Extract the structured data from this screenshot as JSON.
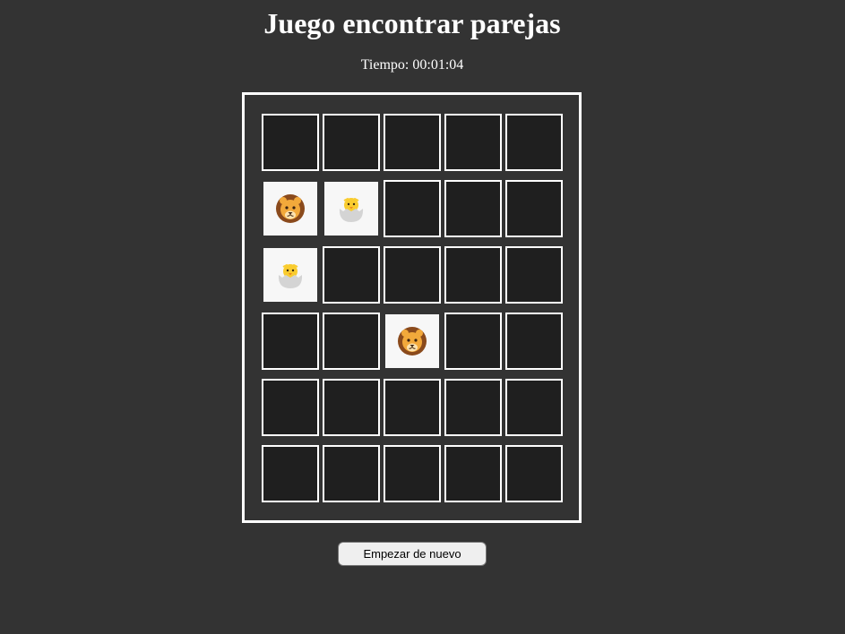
{
  "header": {
    "title": "Juego encontrar parejas"
  },
  "timer": {
    "text": "Tiempo: 00:01:04"
  },
  "board": {
    "rows": 6,
    "cols": 5,
    "cards": [
      {
        "state": "hidden"
      },
      {
        "state": "hidden"
      },
      {
        "state": "hidden"
      },
      {
        "state": "hidden"
      },
      {
        "state": "hidden"
      },
      {
        "state": "revealed",
        "icon": "lion-face-icon"
      },
      {
        "state": "revealed",
        "icon": "hatching-chick-icon"
      },
      {
        "state": "hidden"
      },
      {
        "state": "hidden"
      },
      {
        "state": "hidden"
      },
      {
        "state": "revealed",
        "icon": "hatching-chick-icon"
      },
      {
        "state": "hidden"
      },
      {
        "state": "hidden"
      },
      {
        "state": "hidden"
      },
      {
        "state": "hidden"
      },
      {
        "state": "hidden"
      },
      {
        "state": "hidden"
      },
      {
        "state": "revealed",
        "icon": "lion-face-icon"
      },
      {
        "state": "hidden"
      },
      {
        "state": "hidden"
      },
      {
        "state": "hidden"
      },
      {
        "state": "hidden"
      },
      {
        "state": "hidden"
      },
      {
        "state": "hidden"
      },
      {
        "state": "hidden"
      },
      {
        "state": "hidden"
      },
      {
        "state": "hidden"
      },
      {
        "state": "hidden"
      },
      {
        "state": "hidden"
      },
      {
        "state": "hidden"
      }
    ]
  },
  "controls": {
    "restart_label": "Empezar de nuevo"
  },
  "colors": {
    "page_background": "#333333",
    "card_hidden": "#1f1f1f",
    "card_revealed": "#f7f7f7",
    "border": "#ffffff"
  }
}
